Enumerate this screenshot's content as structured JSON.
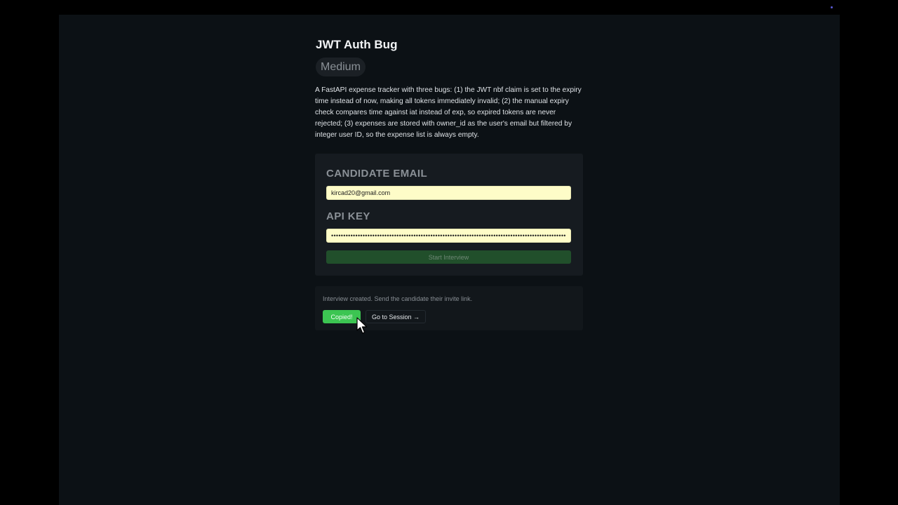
{
  "problem": {
    "title": "JWT Auth Bug",
    "difficulty": "Medium",
    "description": "A FastAPI expense tracker with three bugs: (1) the JWT nbf claim is set to the expiry time instead of now, making all tokens immediately invalid; (2) the manual expiry check compares time against iat instead of exp, so expired tokens are never rejected; (3) expenses are stored with owner_id as the user's email but filtered by integer user ID, so the expense list is always empty."
  },
  "form": {
    "email_label": "CANDIDATE EMAIL",
    "email_value": "kircad20@gmail.com",
    "api_key_label": "API KEY",
    "api_key_value": "••••••••••••••••••••••••••••••••••••••••••••••••••••••••••••••••••••••••••••••••••••••••••••••••••••••",
    "start_button": "Start Interview"
  },
  "result": {
    "message": "Interview created. Send the candidate their invite link.",
    "copy_button": "Copied!",
    "session_button": "Go to Session →"
  },
  "colors": {
    "background": "#0c1115",
    "accent_green": "#3cc552",
    "input_fill": "#fefcc8"
  }
}
